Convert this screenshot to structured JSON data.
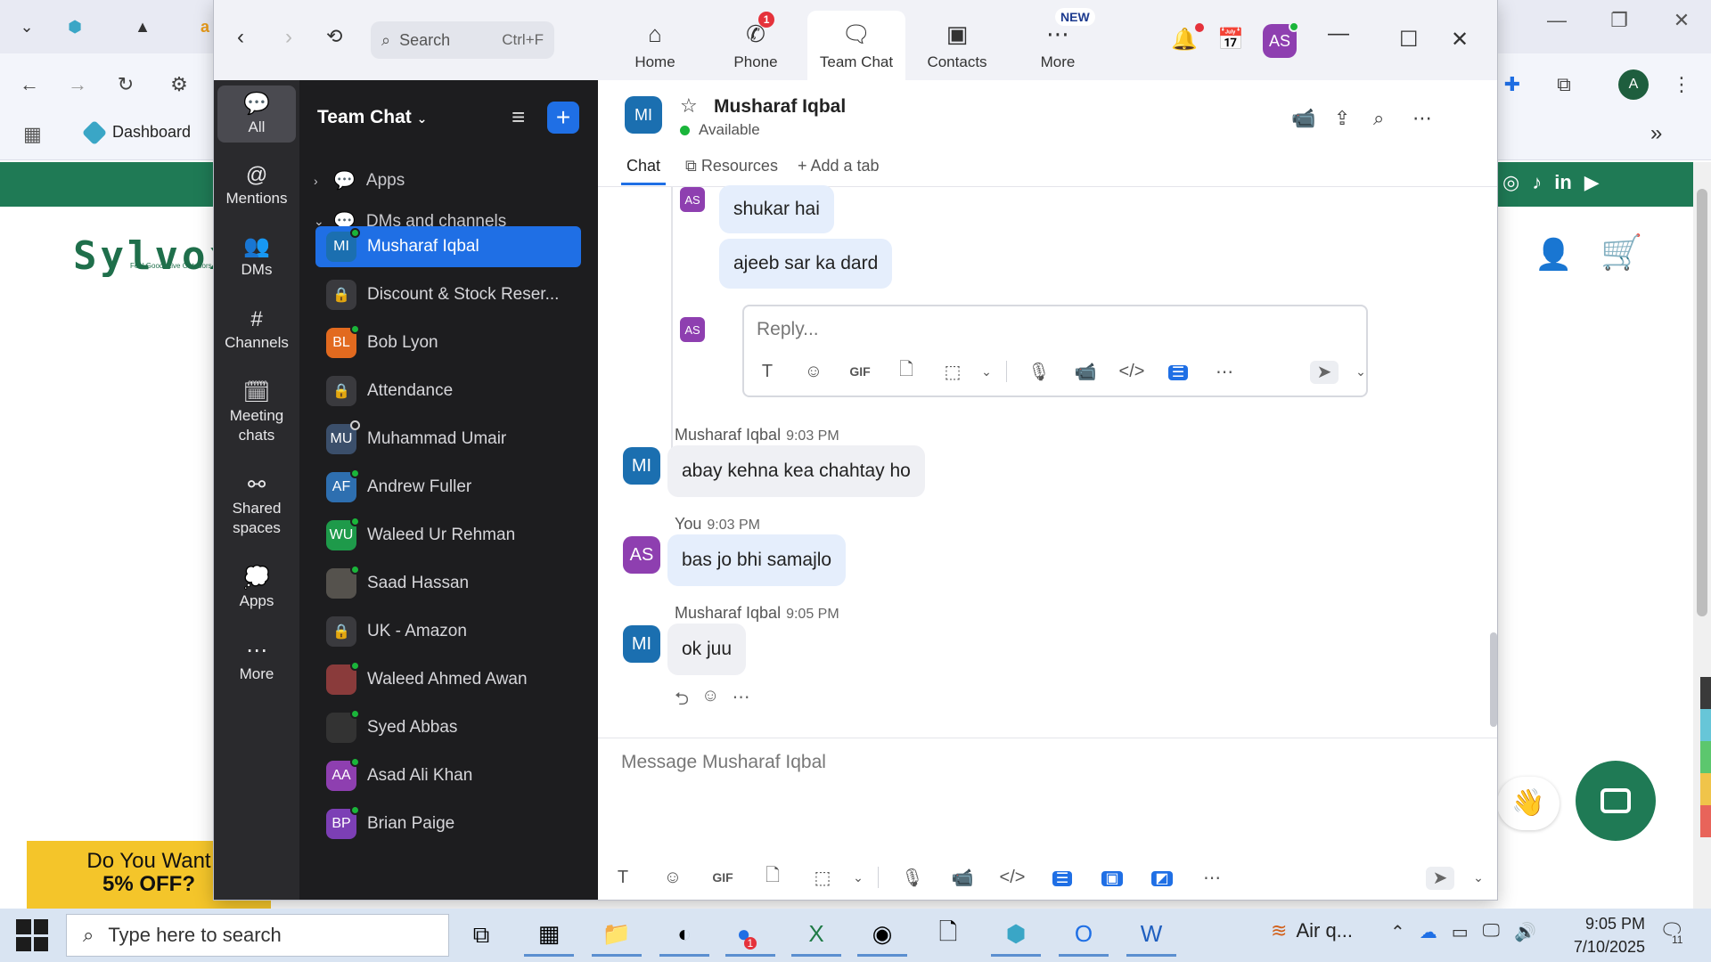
{
  "browser": {
    "bookmark_dashboard": "Dashboard",
    "site_logo": "Sylvox",
    "site_tagline": "Feel Good. Live Outdoors",
    "promo_line1": "Do You Want",
    "promo_line2": "5% OFF?"
  },
  "zoom": {
    "search_placeholder": "Search",
    "search_shortcut": "Ctrl+F",
    "tabs": [
      {
        "label": "Home",
        "icon": "home-icon"
      },
      {
        "label": "Phone",
        "icon": "phone-icon",
        "badge": "1"
      },
      {
        "label": "Team Chat",
        "icon": "chat-icon",
        "active": true
      },
      {
        "label": "Contacts",
        "icon": "contacts-icon"
      },
      {
        "label": "More",
        "icon": "more-icon",
        "badge": "NEW"
      }
    ],
    "user_avatar": "AS",
    "rail": [
      {
        "label": "All",
        "icon": "chat-bubble-icon",
        "active": true
      },
      {
        "label": "Mentions",
        "icon": "at-icon"
      },
      {
        "label": "DMs",
        "icon": "people-icon"
      },
      {
        "label": "Channels",
        "icon": "hash-icon"
      },
      {
        "label": "Meeting chats",
        "icon": "calendar-icon"
      },
      {
        "label": "Shared spaces",
        "icon": "share-icon"
      },
      {
        "label": "Apps",
        "icon": "apps-icon"
      },
      {
        "label": "More",
        "icon": "ellipsis-icon"
      }
    ],
    "channel_list": {
      "title": "Team Chat",
      "section_apps": "Apps",
      "section_dms": "DMs and channels",
      "items": [
        {
          "name": "Musharaf Iqbal",
          "initials": "MI",
          "color": "#1b6fb0",
          "status": "online",
          "active": true
        },
        {
          "name": "Discount & Stock Reser...",
          "initials": "",
          "locked": true
        },
        {
          "name": "Bob Lyon",
          "initials": "BL",
          "color": "#e26a1f",
          "status": "online"
        },
        {
          "name": "Attendance",
          "initials": "",
          "locked": true
        },
        {
          "name": "Muhammad Umair",
          "initials": "MU",
          "color": "#3b4f6b",
          "status": "offline"
        },
        {
          "name": "Andrew Fuller",
          "initials": "AF",
          "color": "#2e6fb0",
          "status": "online"
        },
        {
          "name": "Waleed Ur Rehman",
          "initials": "WU",
          "color": "#1e9a4a",
          "status": "online"
        },
        {
          "name": "Saad Hassan",
          "initials": "",
          "color": "#55524d",
          "status": "online"
        },
        {
          "name": "UK - Amazon",
          "initials": "",
          "locked": true
        },
        {
          "name": "Waleed Ahmed Awan",
          "initials": "",
          "color": "#8a3b3b",
          "status": "online"
        },
        {
          "name": "Syed Abbas",
          "initials": "",
          "color": "#333333",
          "status": "online"
        },
        {
          "name": "Asad Ali Khan",
          "initials": "AA",
          "color": "#8e3fb0",
          "status": "online"
        },
        {
          "name": "Brian Paige",
          "initials": "BP",
          "color": "#7c3fb5",
          "status": "online"
        }
      ]
    },
    "chat": {
      "contact_initials": "MI",
      "contact_name": "Musharaf Iqbal",
      "contact_status": "Available",
      "tab_chat": "Chat",
      "tab_resources": "Resources",
      "tab_add": "Add a tab",
      "thread_messages": [
        "shukar hai",
        "ajeeb sar ka dard"
      ],
      "thread_avatar": "AS",
      "reply_placeholder": "Reply...",
      "messages": [
        {
          "author": "Musharaf Iqbal",
          "time": "9:03 PM",
          "initials": "MI",
          "text": "abay kehna kea chahtay ho"
        },
        {
          "author": "You",
          "time": "9:03 PM",
          "initials": "AS",
          "text": "bas jo bhi samajlo"
        },
        {
          "author": "Musharaf Iqbal",
          "time": "9:05 PM",
          "initials": "MI",
          "text": "ok juu"
        }
      ],
      "composer_placeholder": "Message Musharaf Iqbal"
    }
  },
  "taskbar": {
    "search_placeholder": "Type here to search",
    "air_quality": "Air q...",
    "time": "9:05 PM",
    "date": "7/10/2025",
    "notification_count": "11",
    "zoom_badge": "1"
  },
  "colors": {
    "accent": "#1f6fe5",
    "site_green": "#1f7a55",
    "online": "#1ab53a"
  }
}
